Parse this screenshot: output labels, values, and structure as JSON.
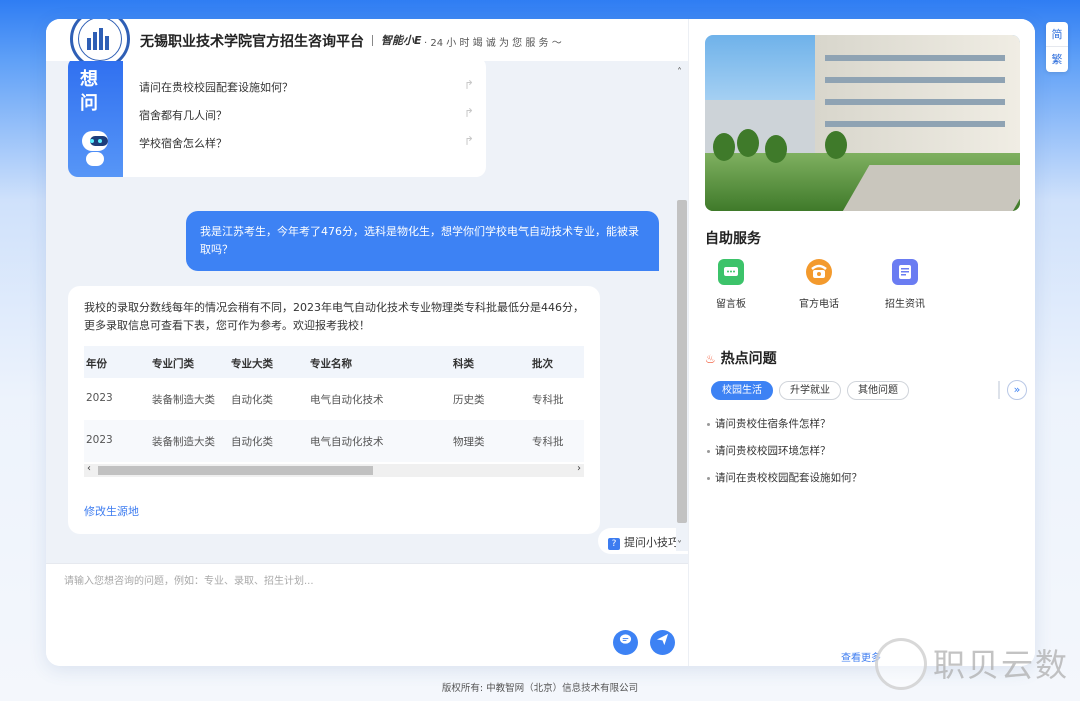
{
  "header": {
    "title": "无锡职业技术学院官方招生咨询平台",
    "brand": "智能小E",
    "slogan": "· 24 小 时 竭 诚 为 您 服 务 ～"
  },
  "faq": {
    "side_chars": [
      "想",
      "问"
    ],
    "items": [
      "请问在贵校校园配套设施如何？",
      "宿舍都有几人间？",
      "学校宿舍怎么样？"
    ]
  },
  "user_message": "我是江苏考生，今年考了476分，选科是物化生，想学你们学校电气自动技术专业，能被录取吗？",
  "bot_message": {
    "text": "我校的录取分数线每年的情况会稍有不同，2023年电气自动化技术专业物理类专科批最低分是446分，更多录取信息可查看下表，您可作为参考。欢迎报考我校！",
    "table": {
      "headers": [
        "年份",
        "专业门类",
        "专业大类",
        "专业名称",
        "科类",
        "批次"
      ],
      "rows": [
        [
          "2023",
          "装备制造大类",
          "自动化类",
          "电气自动化技术",
          "历史类",
          "专科批"
        ],
        [
          "2023",
          "装备制造大类",
          "自动化类",
          "电气自动化技术",
          "物理类",
          "专科批"
        ]
      ]
    },
    "link": "修改生源地"
  },
  "tips_label": "提问小技巧",
  "input": {
    "placeholder": "请输入您想咨询的问题，例如：专业、录取、招生计划..."
  },
  "right": {
    "self_service_title": "自助服务",
    "services": [
      {
        "label": "留言板",
        "icon": "message-board-icon",
        "color": "#3cc36a"
      },
      {
        "label": "官方电话",
        "icon": "phone-icon",
        "color": "#f39a2d"
      },
      {
        "label": "招生资讯",
        "icon": "news-icon",
        "color": "#6a7cf2"
      }
    ],
    "hot_title": "热点问题",
    "tabs": [
      "校园生活",
      "升学就业",
      "其他问题"
    ],
    "questions": [
      "请问贵校住宿条件怎样？",
      "请问贵校校园环境怎样？",
      "请问在贵校校园配套设施如何？"
    ],
    "see_more": "查看更多"
  },
  "lang": {
    "simplified": "简",
    "traditional": "繁"
  },
  "footer": "版权所有: 中教智网（北京）信息技术有限公司",
  "watermark": "职贝云数",
  "colors": {
    "accent": "#3d82f4",
    "brand_blue": "#2f5fb5"
  }
}
